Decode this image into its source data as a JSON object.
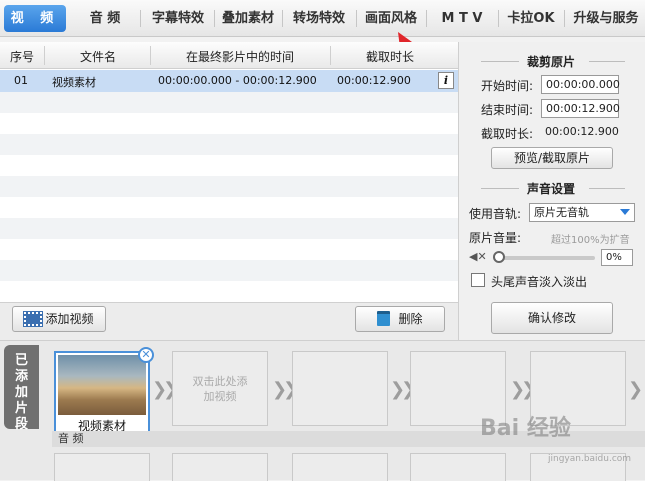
{
  "tabs": [
    "视 频",
    "音 频",
    "字幕特效",
    "叠加素材",
    "转场特效",
    "画面风格",
    "M T V",
    "卡拉OK",
    "升级与服务"
  ],
  "table": {
    "headers": [
      "序号",
      "文件名",
      "在最终影片中的时间",
      "截取时长"
    ],
    "row": {
      "num": "01",
      "name": "视频素材",
      "time": "00:00:00.000 - 00:00:12.900",
      "duration": "00:00:12.900",
      "info": "i"
    }
  },
  "buttons": {
    "add_video": "添加视频",
    "delete": "删除",
    "confirm": "确认修改",
    "preview": "预览/截取原片"
  },
  "crop": {
    "title": "裁剪原片",
    "start_label": "开始时间:",
    "start_value": "00:00:00.000",
    "end_label": "结束时间:",
    "end_value": "00:00:12.900",
    "dur_label": "截取时长:",
    "dur_value": "00:00:12.900"
  },
  "audio": {
    "title": "声音设置",
    "track_label": "使用音轨:",
    "track_value": "原片无音轨",
    "volume_label": "原片音量:",
    "hint": "超过100%为扩音",
    "volume_value": "0%",
    "fade_label": "头尾声音淡入淡出"
  },
  "timeline": {
    "side_tab": "已添加片段",
    "clip_label": "视频素材",
    "placeholder": "双击此处添加视频",
    "audio_label": "音 频",
    "close": "✕"
  },
  "watermark": {
    "logo": "Bai 经验",
    "url": "jingyan.baidu.com"
  },
  "colors": {
    "accent": "#2a7ad6",
    "selected_row": "#c8dcf4",
    "arrow": "#e0262b"
  }
}
